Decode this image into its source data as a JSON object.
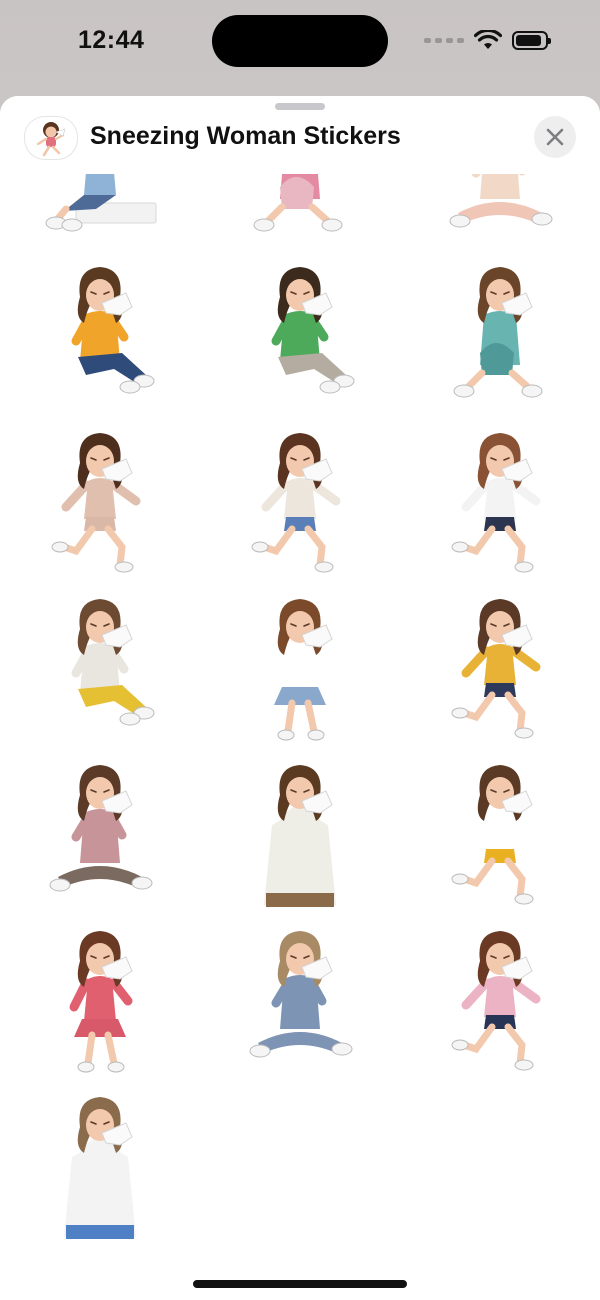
{
  "status_bar": {
    "time": "12:44",
    "icons": [
      "cellular-icon",
      "wifi-icon",
      "battery-icon"
    ],
    "battery_level": 0.9
  },
  "sheet": {
    "title": "Sneezing Woman Stickers",
    "app_icon": "sneezing-woman-app-icon",
    "close_icon": "close-icon"
  },
  "stickers": [
    {
      "pose": "sitting-on-block",
      "hair": "#5a3a24",
      "top": "#8fb3d6",
      "bottom": "#4d6b96"
    },
    {
      "pose": "sitting-hugging-knees",
      "hair": "#6b4226",
      "top": "#e58aa3",
      "bottom": "#e9b7c2"
    },
    {
      "pose": "sitting-cross-legged",
      "hair": "#7a5236",
      "top": "#f1d8c7",
      "bottom": "#f0c6b6"
    },
    {
      "pose": "sitting-sneeze",
      "hair": "#5b3a22",
      "top": "#f0a52a",
      "bottom": "#2f4b7a"
    },
    {
      "pose": "sitting-sneeze",
      "hair": "#3c2a1c",
      "top": "#4caa5a",
      "bottom": "#b4aca0"
    },
    {
      "pose": "sitting-hugging-knees",
      "hair": "#6a4529",
      "top": "#68b4b0",
      "bottom": "#4f9a98"
    },
    {
      "pose": "running",
      "hair": "#4e2e1c",
      "top": "#e0bfae",
      "bottom": "#d9b8a8"
    },
    {
      "pose": "running",
      "hair": "#5a3420",
      "top": "#ece6dc",
      "bottom": "#5a7fb8"
    },
    {
      "pose": "running",
      "hair": "#8a5234",
      "top": "#f3f3f3",
      "bottom": "#2b3550"
    },
    {
      "pose": "sitting-sneeze",
      "hair": "#6d4a32",
      "top": "#e9e6e0",
      "bottom": "#e6c033"
    },
    {
      "pose": "standing",
      "hair": "#7a4a2a",
      "top": "#ffffff",
      "bottom": "#8aa8cc"
    },
    {
      "pose": "running",
      "hair": "#5a3a26",
      "top": "#e8b237",
      "bottom": "#2d3a5c"
    },
    {
      "pose": "sitting-cross-legged",
      "hair": "#5c3a28",
      "top": "#c7949a",
      "bottom": "#7a6a60"
    },
    {
      "pose": "standing-portrait",
      "hair": "#5b3a22",
      "top": "#efeee6",
      "bottom": "#8a6a48"
    },
    {
      "pose": "running",
      "hair": "#5a3a24",
      "top": "#ffffff",
      "bottom": "#e9b021"
    },
    {
      "pose": "standing",
      "hair": "#6a3a24",
      "top": "#e06070",
      "bottom": "#d85a6a"
    },
    {
      "pose": "sitting-cross-legged",
      "hair": "#a88a64",
      "top": "#7e94b4",
      "bottom": "#7e94b4"
    },
    {
      "pose": "running",
      "hair": "#6a3a24",
      "top": "#ebb3c4",
      "bottom": "#263455"
    },
    {
      "pose": "standing-portrait",
      "hair": "#8a6c4c",
      "top": "#f3f3f3",
      "bottom": "#4f7fc4"
    }
  ]
}
